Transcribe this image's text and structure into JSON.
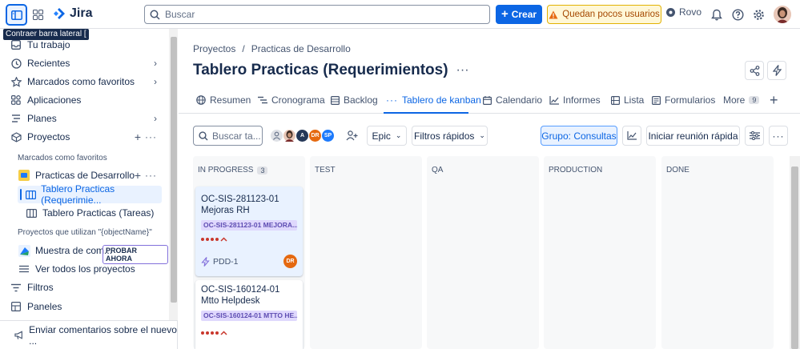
{
  "topbar": {
    "app_name": "Jira",
    "search_placeholder": "Buscar",
    "create_label": "Crear",
    "warning_label": "Quedan pocos usuarios",
    "rovo_label": "Rovo",
    "tooltip": "Contraer barra lateral ["
  },
  "sidebar": {
    "items": [
      {
        "label": "Tu trabajo",
        "icon": "inbox-icon"
      },
      {
        "label": "Recientes",
        "icon": "clock-icon"
      },
      {
        "label": "Marcados como favoritos",
        "icon": "star-icon"
      },
      {
        "label": "Aplicaciones",
        "icon": "apps-icon"
      },
      {
        "label": "Planes",
        "icon": "plans-icon"
      },
      {
        "label": "Proyectos",
        "icon": "projects-icon"
      }
    ],
    "section_favorites": "Marcados como favoritos",
    "favorite_project": "Practicas de Desarrollo",
    "board_active": "Tablero Practicas (Requerimie...",
    "board_other": "Tablero Practicas (Tareas)",
    "section_using": "Proyectos que utilizan \"{objectName}\"",
    "sample_project": "Muestra de com...",
    "try_badge": "PROBAR AHORA",
    "view_all": "Ver todos los proyectos",
    "filters": "Filtros",
    "dashboards": "Paneles",
    "feedback": "Enviar comentarios sobre el nuevo ..."
  },
  "main": {
    "breadcrumb": [
      "Proyectos",
      "/",
      "Practicas de Desarrollo"
    ],
    "title": "Tablero Practicas (Requerimientos)",
    "tabs": [
      {
        "label": "Resumen",
        "icon": "globe-icon"
      },
      {
        "label": "Cronograma",
        "icon": "timeline-icon"
      },
      {
        "label": "Backlog",
        "icon": "backlog-icon"
      },
      {
        "label": "Tablero de kanban",
        "icon": "board-icon"
      },
      {
        "label": "Calendario",
        "icon": "calendar-icon"
      },
      {
        "label": "Informes",
        "icon": "chart-icon"
      },
      {
        "label": "Lista",
        "icon": "list-icon"
      },
      {
        "label": "Formularios",
        "icon": "forms-icon"
      },
      {
        "label": "More",
        "icon": ""
      }
    ],
    "more_count": "9",
    "toolbar": {
      "search_placeholder": "Buscar ta...",
      "avatars": [
        "A",
        "DR",
        "SP"
      ],
      "epic_label": "Epic",
      "quick_filters_label": "Filtros rápidos",
      "group_label": "Grupo: Consultas",
      "standup_label": "Iniciar reunión rápida"
    },
    "columns": [
      {
        "title": "IN PROGRESS",
        "count": "3"
      },
      {
        "title": "TEST",
        "count": ""
      },
      {
        "title": "QA",
        "count": ""
      },
      {
        "title": "PRODUCTION",
        "count": ""
      },
      {
        "title": "DONE",
        "count": ""
      }
    ],
    "cards": [
      {
        "title_line1": "OC-SIS-281123-01",
        "title_line2": "Mejoras RH",
        "epic": "OC-SIS-281123-01 MEJORA...",
        "key": "PDD-1",
        "assignee": "DR"
      },
      {
        "title_line1": "OC-SIS-160124-01",
        "title_line2": "Mtto Helpdesk",
        "epic": "OC-SIS-160124-01 MTTO HE..."
      }
    ]
  },
  "colors": {
    "accent": "#0c66e4",
    "warning_bg": "#fff7d6",
    "epic_bg": "#dfd8fd",
    "epic_text": "#5e4db2",
    "priority": "#c9372c"
  }
}
